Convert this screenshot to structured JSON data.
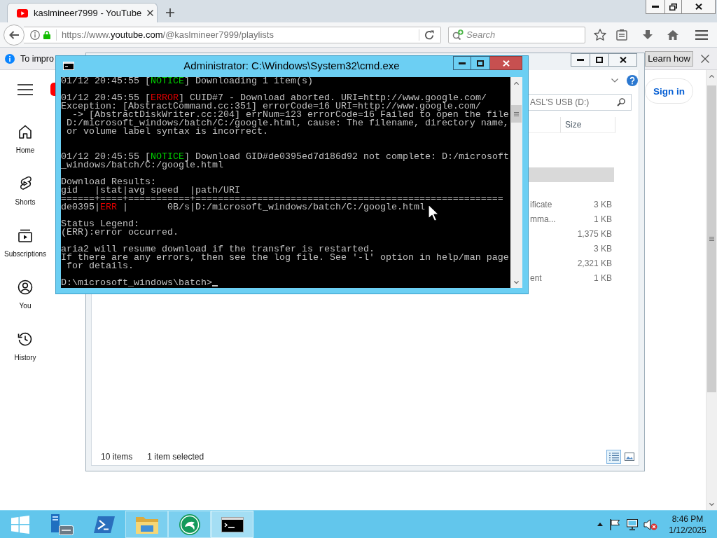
{
  "browser": {
    "tabs": [
      {
        "title": "kaslmineer7999 - YouTube",
        "selected": true
      }
    ],
    "address": {
      "scheme": "https://www.",
      "domain": "youtube.com",
      "path": "/@kaslmineer7999/playlists"
    },
    "search": {
      "placeholder": "Search"
    },
    "notification": {
      "text": "To impro",
      "button": "Learn how"
    },
    "sidebar": {
      "items": [
        {
          "label": "Home",
          "selected": false
        },
        {
          "label": "Shorts",
          "selected": false
        },
        {
          "label": "Subscriptions",
          "selected": false
        },
        {
          "label": "You",
          "selected": false
        },
        {
          "label": "History",
          "selected": false
        }
      ]
    },
    "sign_in": "Sign in"
  },
  "explorer": {
    "search": {
      "placeholder": "ASL'S USB (D:)"
    },
    "columns": [
      "Size"
    ],
    "rows": [
      {
        "selected": false
      },
      {
        "selected": false
      },
      {
        "selected": true
      },
      {
        "selected": false
      },
      {
        "column_1": "ificate",
        "size": "3 KB",
        "selected": false
      },
      {
        "column_1": "mma...",
        "size": "1 KB",
        "selected": false
      },
      {
        "size": "1,375 KB",
        "selected": false
      },
      {
        "size": "3 KB",
        "selected": false
      },
      {
        "size": "2,321 KB",
        "selected": false
      },
      {
        "column_1": "ent",
        "size": "1 KB",
        "selected": false
      }
    ],
    "status": {
      "count": "10 items",
      "selection": "1 item selected"
    },
    "views": [
      {
        "selected": true
      },
      {
        "selected": false
      }
    ]
  },
  "cmd": {
    "title": "Administrator: C:\\Windows\\System32\\cmd.exe",
    "lines": [
      {
        "kind": "text",
        "segments": [
          {
            "text": "01/12 20:45:55 ["
          },
          {
            "text": "NOTICE",
            "color": "#00d000"
          },
          {
            "text": "] Downloading 1 item(s)"
          }
        ]
      },
      {
        "kind": "blank"
      },
      {
        "kind": "text",
        "segments": [
          {
            "text": "01/12 20:45:55 ["
          },
          {
            "text": "ERROR",
            "color": "#e00000"
          },
          {
            "text": "] CUID#7 - Download aborted. URI=http://www.google.com/"
          }
        ]
      },
      {
        "kind": "text",
        "text": "Exception: [AbstractCommand.cc:351] errorCode=16 URI=http://www.google.com/"
      },
      {
        "kind": "text",
        "text": "  -> [AbstractDiskWriter.cc:204] errNum=123 errorCode=16 Failed to open the file"
      },
      {
        "kind": "text",
        "text": " D:/microsoft_windows/batch/C:/google.html, cause: The filename, directory name,"
      },
      {
        "kind": "text",
        "text": " or volume label syntax is incorrect."
      },
      {
        "kind": "blank"
      },
      {
        "kind": "blank"
      },
      {
        "kind": "text",
        "segments": [
          {
            "text": "01/12 20:45:55 ["
          },
          {
            "text": "NOTICE",
            "color": "#00d000"
          },
          {
            "text": "] Download GID#de0395ed7d186d92 not complete: D:/microsoft"
          }
        ]
      },
      {
        "kind": "text",
        "text": "_windows/batch/C:/google.html"
      },
      {
        "kind": "blank"
      },
      {
        "kind": "text",
        "text": "Download Results:"
      },
      {
        "kind": "text",
        "text": "gid   |stat|avg speed  |path/URI"
      },
      {
        "kind": "text",
        "text": "======+====+===========+======================================================="
      },
      {
        "kind": "text",
        "segments": [
          {
            "text": "de0395|"
          },
          {
            "text": "ERR",
            "color": "#e00000"
          },
          {
            "text": " |       0B/s|D:/microsoft_windows/batch/C:/google.html"
          }
        ]
      },
      {
        "kind": "blank"
      },
      {
        "kind": "text",
        "text": "Status Legend:"
      },
      {
        "kind": "text",
        "text": "(ERR):error occurred."
      },
      {
        "kind": "blank"
      },
      {
        "kind": "text",
        "text": "aria2 will resume download if the transfer is restarted."
      },
      {
        "kind": "text",
        "text": "If there are any errors, then see the log file. See '-l' option in help/man page"
      },
      {
        "kind": "text",
        "text": " for details."
      },
      {
        "kind": "blank"
      },
      {
        "kind": "prompt",
        "text": "D:\\microsoft_windows\\batch>"
      }
    ]
  },
  "taskbar": {
    "apps": [
      {
        "running": false,
        "selected": false
      },
      {
        "running": false,
        "selected": false
      },
      {
        "running": true,
        "selected": false
      },
      {
        "running": true,
        "selected": false
      },
      {
        "running": true,
        "selected": true
      }
    ],
    "volume_muted": true,
    "time": "8:46 PM",
    "date": "1/12/2025"
  }
}
